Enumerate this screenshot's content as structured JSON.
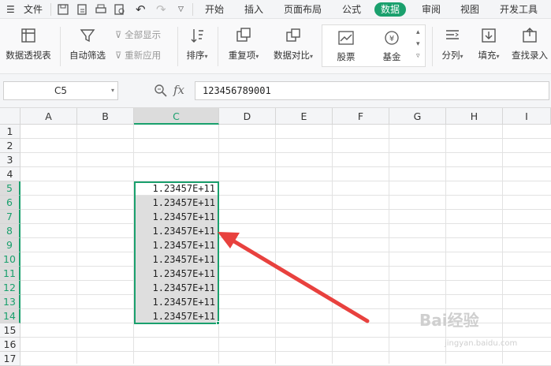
{
  "menubar": {
    "file_label": "文件",
    "tabs": [
      "开始",
      "插入",
      "页面布局",
      "公式",
      "数据",
      "审阅",
      "视图",
      "开发工具"
    ],
    "active_tab": "数据"
  },
  "ribbon": {
    "pivot_label": "数据透视表",
    "autofilter_label": "自动筛选",
    "show_all_label": "全部显示",
    "reapply_label": "重新应用",
    "sort_label": "排序",
    "duplicates_label": "重复项",
    "compare_label": "数据对比",
    "stock_label": "股票",
    "fund_label": "基金",
    "split_label": "分列",
    "fill_label": "填充",
    "lookup_label": "查找录入"
  },
  "formula_bar": {
    "name_box": "C5",
    "fx_label": "fx",
    "formula_value": "123456789001"
  },
  "sheet": {
    "columns": [
      "A",
      "B",
      "C",
      "D",
      "E",
      "F",
      "G",
      "H",
      "I"
    ],
    "selected_column": "C",
    "rows": [
      "1",
      "2",
      "3",
      "4",
      "5",
      "6",
      "7",
      "8",
      "9",
      "10",
      "11",
      "12",
      "13",
      "14",
      "15",
      "16",
      "17"
    ],
    "selected_rows": [
      "5",
      "6",
      "7",
      "8",
      "9",
      "10",
      "11",
      "12",
      "13",
      "14"
    ],
    "c_values": [
      "1.23457E+11",
      "1.23457E+11",
      "1.23457E+11",
      "1.23457E+11",
      "1.23457E+11",
      "1.23457E+11",
      "1.23457E+11",
      "1.23457E+11",
      "1.23457E+11",
      "1.23457E+11"
    ]
  },
  "annotation": {
    "arrow_color": "#e8413e"
  },
  "watermark": {
    "brand": "Bai经验",
    "url": "jingyan.baidu.com"
  },
  "colors": {
    "accent": "#1aa06d",
    "selection_shade": "#dedede"
  }
}
